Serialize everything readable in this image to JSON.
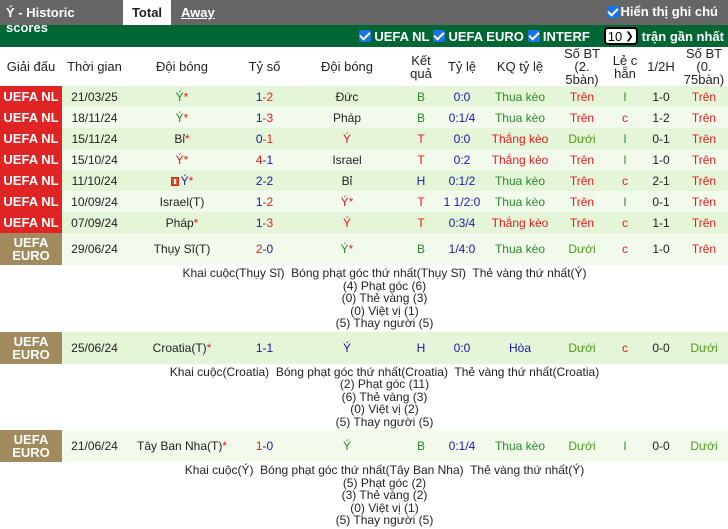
{
  "header": {
    "title": "Ý - Historic scores",
    "tabs": [
      {
        "label": "Total",
        "active": true
      },
      {
        "label": "Away",
        "active": false
      }
    ],
    "show_notes_label": "Hiển thị ghi chú",
    "show_notes_checked": true
  },
  "filters": {
    "items": [
      {
        "label": "UEFA NL",
        "checked": true
      },
      {
        "label": "UEFA EURO",
        "checked": true
      },
      {
        "label": "INTERF",
        "checked": true
      }
    ],
    "recent_count": "10",
    "recent_label": "trận gần nhất"
  },
  "columns": [
    "Giải đấu",
    "Thời gian",
    "Đội bóng",
    "Tỷ số",
    "Đội bóng",
    "Kết quả",
    "Tỷ lệ",
    "KQ tỷ lệ",
    "Số BT (2. 5bàn)",
    "Lẻ c hẵn",
    "1/2H",
    "Số BT (0. 75bàn)"
  ],
  "colors": {
    "uefa_nl": "#e02424",
    "uefa_euro": "#a08a5e",
    "header_bar": "#666666",
    "filter_bar": "#006633"
  },
  "matches": [
    {
      "league": "UEFA NL",
      "league_type": "nl",
      "date": "21/03/25",
      "home": "Ý",
      "home_star": "*",
      "home_color": "green",
      "score_h": "1",
      "score_a": "2",
      "score_h_color": "blue",
      "score_a_color": "red",
      "away": "Đức",
      "away_star": "",
      "away_color": "dark",
      "result": "B",
      "result_color": "green",
      "odds": "0:0",
      "odds_result": "Thua kèo",
      "odds_result_color": "green",
      "ou25": "Trên",
      "ou25_color": "red",
      "oe": "l",
      "oe_color": "green",
      "half": "1-0",
      "ou075": "Trên",
      "ou075_color": "red"
    },
    {
      "league": "UEFA NL",
      "league_type": "nl",
      "date": "18/11/24",
      "home": "Ý",
      "home_star": "*",
      "home_color": "green",
      "score_h": "1",
      "score_a": "3",
      "score_h_color": "blue",
      "score_a_color": "red",
      "away": "Pháp",
      "away_star": "",
      "away_color": "dark",
      "result": "B",
      "result_color": "green",
      "odds": "0:1/4",
      "odds_result": "Thua kèo",
      "odds_result_color": "green",
      "ou25": "Trên",
      "ou25_color": "red",
      "oe": "c",
      "oe_color": "red",
      "half": "1-2",
      "ou075": "Trên",
      "ou075_color": "red"
    },
    {
      "league": "UEFA NL",
      "league_type": "nl",
      "date": "15/11/24",
      "home": "Bỉ",
      "home_star": "*",
      "home_color": "dark",
      "score_h": "0",
      "score_a": "1",
      "score_h_color": "blue",
      "score_a_color": "red",
      "away": "Ý",
      "away_star": "",
      "away_color": "red",
      "result": "T",
      "result_color": "red",
      "odds": "0:0",
      "odds_result": "Thắng kèo",
      "odds_result_color": "red",
      "ou25": "Dưới",
      "ou25_color": "olive",
      "oe": "l",
      "oe_color": "green",
      "half": "0-1",
      "ou075": "Trên",
      "ou075_color": "red"
    },
    {
      "league": "UEFA NL",
      "league_type": "nl",
      "date": "15/10/24",
      "home": "Ý",
      "home_star": "*",
      "home_color": "red",
      "score_h": "4",
      "score_a": "1",
      "score_h_color": "red",
      "score_a_color": "blue",
      "away": "Israel",
      "away_star": "",
      "away_color": "dark",
      "result": "T",
      "result_color": "red",
      "odds": "0:2",
      "odds_result": "Thắng kèo",
      "odds_result_color": "red",
      "ou25": "Trên",
      "ou25_color": "red",
      "oe": "l",
      "oe_color": "green",
      "half": "1-0",
      "ou075": "Trên",
      "ou075_color": "red"
    },
    {
      "league": "UEFA NL",
      "league_type": "nl",
      "date": "11/10/24",
      "home": "Ý",
      "home_star": "*",
      "home_flag": true,
      "home_color": "blue",
      "score_h": "2",
      "score_a": "2",
      "score_h_color": "blue",
      "score_a_color": "blue",
      "away": "Bỉ",
      "away_star": "",
      "away_color": "dark",
      "result": "H",
      "result_color": "blue",
      "odds": "0:1/2",
      "odds_result": "Thua kèo",
      "odds_result_color": "green",
      "ou25": "Trên",
      "ou25_color": "red",
      "oe": "c",
      "oe_color": "red",
      "half": "2-1",
      "ou075": "Trên",
      "ou075_color": "red"
    },
    {
      "league": "UEFA NL",
      "league_type": "nl",
      "date": "10/09/24",
      "home": "Israel(T)",
      "home_star": "",
      "home_color": "dark",
      "score_h": "1",
      "score_a": "2",
      "score_h_color": "blue",
      "score_a_color": "red",
      "away": "Ý",
      "away_star": "*",
      "away_color": "red",
      "result": "T",
      "result_color": "red",
      "odds": "1 1/2:0",
      "odds_result": "Thua kèo",
      "odds_result_color": "green",
      "ou25": "Trên",
      "ou25_color": "red",
      "oe": "l",
      "oe_color": "green",
      "half": "0-1",
      "ou075": "Trên",
      "ou075_color": "red"
    },
    {
      "league": "UEFA NL",
      "league_type": "nl",
      "date": "07/09/24",
      "home": "Pháp",
      "home_star": "*",
      "home_color": "dark",
      "score_h": "1",
      "score_a": "3",
      "score_h_color": "blue",
      "score_a_color": "red",
      "away": "Ý",
      "away_star": "",
      "away_color": "red",
      "result": "T",
      "result_color": "red",
      "odds": "0:3/4",
      "odds_result": "Thắng kèo",
      "odds_result_color": "red",
      "ou25": "Trên",
      "ou25_color": "red",
      "oe": "c",
      "oe_color": "red",
      "half": "1-1",
      "ou075": "Trên",
      "ou075_color": "red"
    },
    {
      "league": "UEFA EURO",
      "league_type": "euro",
      "date": "29/06/24",
      "home": "Thụy Sĩ(T)",
      "home_star": "",
      "home_color": "dark",
      "score_h": "2",
      "score_a": "0",
      "score_h_color": "red",
      "score_a_color": "blue",
      "away": "Ý",
      "away_star": "*",
      "away_color": "green",
      "result": "B",
      "result_color": "green",
      "odds": "1/4:0",
      "odds_result": "Thua kèo",
      "odds_result_color": "green",
      "ou25": "Dưới",
      "ou25_color": "olive",
      "oe": "c",
      "oe_color": "red",
      "half": "1-0",
      "ou075": "Trên",
      "ou075_color": "red",
      "details": [
        "Khai cuộc(Thụy Sĩ)  Bóng phạt góc thứ nhất(Thụy Sĩ)  Thẻ vàng thứ nhất(Ý)",
        "(4) Phạt góc (6)",
        "(0) Thẻ vàng (3)",
        "(0) Việt vị (1)",
        "(5) Thay người (5)"
      ]
    },
    {
      "league": "UEFA EURO",
      "league_type": "euro",
      "date": "25/06/24",
      "home": "Croatia(T)",
      "home_star": "*",
      "home_color": "dark",
      "score_h": "1",
      "score_a": "1",
      "score_h_color": "blue",
      "score_a_color": "blue",
      "away": "Ý",
      "away_star": "",
      "away_color": "blue",
      "result": "H",
      "result_color": "blue",
      "odds": "0:0",
      "odds_result": "Hòa",
      "odds_result_color": "blue",
      "ou25": "Dưới",
      "ou25_color": "olive",
      "oe": "c",
      "oe_color": "red",
      "half": "0-0",
      "ou075": "Dưới",
      "ou075_color": "olive",
      "details": [
        "Khai cuộc(Croatia)  Bóng phạt góc thứ nhất(Croatia)  Thẻ vàng thứ nhất(Croatia)",
        "(2) Phạt góc (11)",
        "(6) Thẻ vàng (3)",
        "(0) Việt vị (2)",
        "(5) Thay người (5)"
      ]
    },
    {
      "league": "UEFA EURO",
      "league_type": "euro",
      "date": "21/06/24",
      "home": "Tây Ban Nha(T)",
      "home_star": "*",
      "home_color": "dark",
      "score_h": "1",
      "score_a": "0",
      "score_h_color": "red",
      "score_a_color": "blue",
      "away": "Ý",
      "away_star": "",
      "away_color": "green",
      "result": "B",
      "result_color": "green",
      "odds": "0:1/4",
      "odds_result": "Thua kèo",
      "odds_result_color": "green",
      "ou25": "Dưới",
      "ou25_color": "olive",
      "oe": "l",
      "oe_color": "green",
      "half": "0-0",
      "ou075": "Dưới",
      "ou075_color": "olive",
      "details": [
        "Khai cuộc(Ý)  Bóng phạt góc thứ nhất(Tây Ban Nha)  Thẻ vàng thứ nhất(Ý)",
        "(5) Phạt góc (2)",
        "(3) Thẻ vàng (2)",
        "(0) Việt vị (1)",
        "(5) Thay người (5)"
      ]
    }
  ]
}
